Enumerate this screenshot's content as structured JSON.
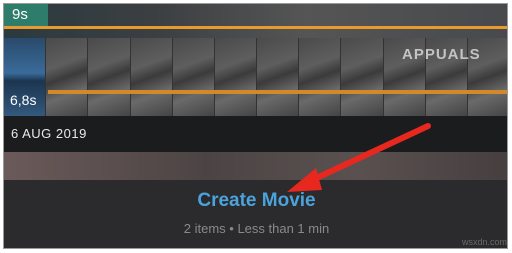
{
  "timeline": {
    "top_duration": "9s",
    "clip_duration": "6,8s",
    "date": "6 AUG 2019"
  },
  "action": {
    "label": "Create Movie",
    "subtitle": "2 items • Less than 1 min"
  },
  "branding": {
    "logo": "APPUALS",
    "watermark": "wsxdn.com"
  },
  "colors": {
    "accent": "#4ba3dc",
    "timeline_orange": "#e89a2c",
    "arrow_red": "#e8281e"
  }
}
